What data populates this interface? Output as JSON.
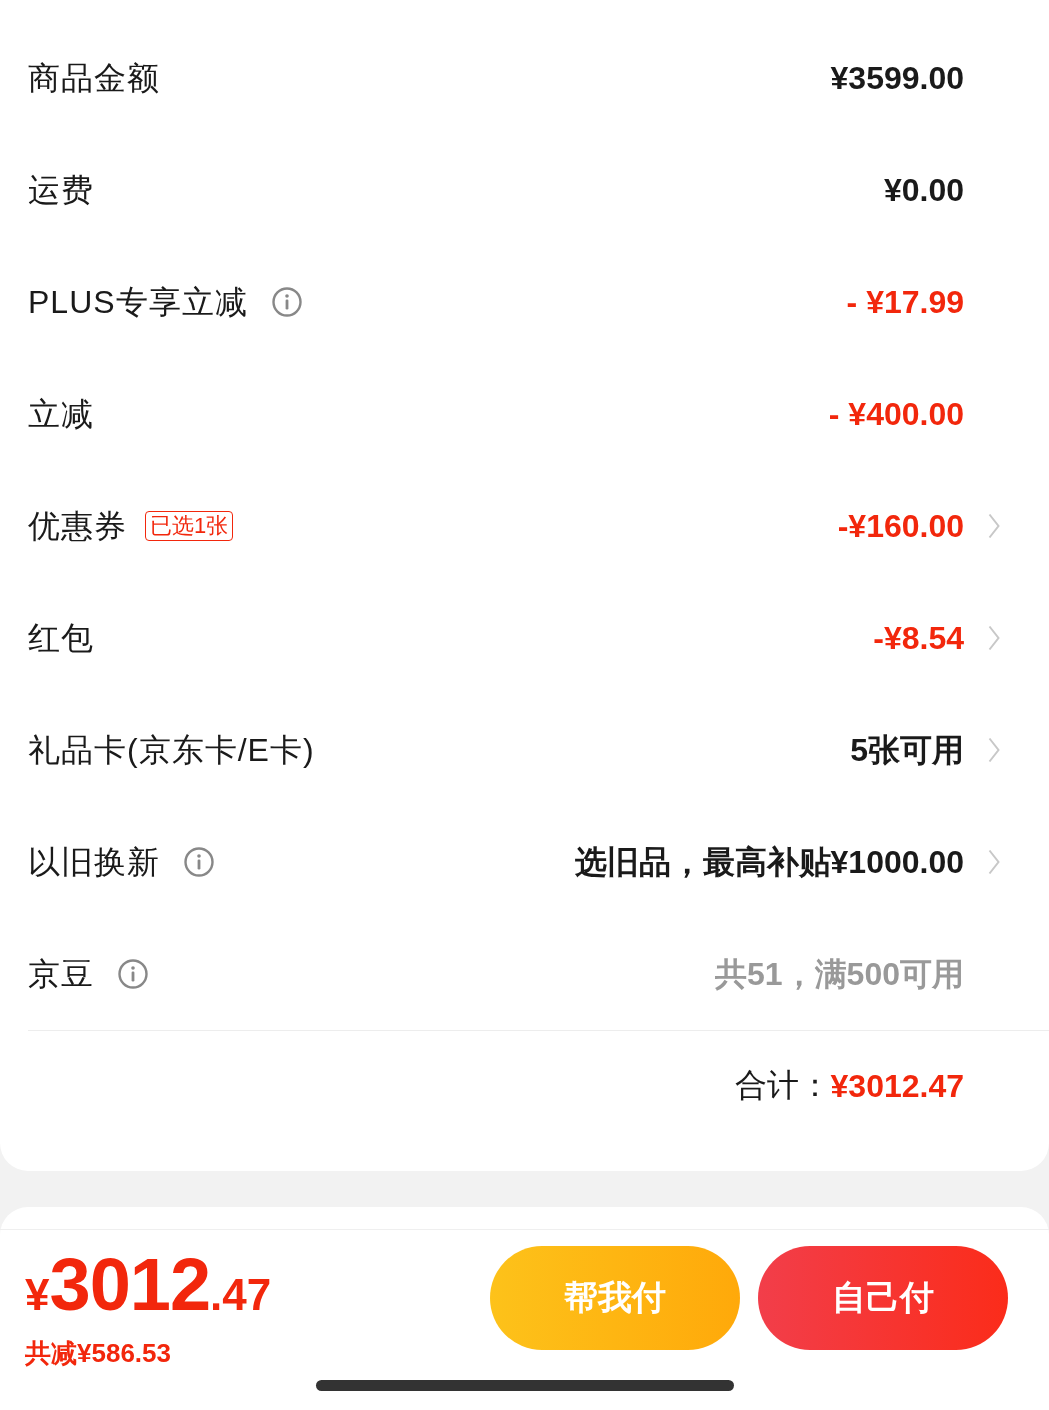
{
  "summary": {
    "rows": [
      {
        "label": "商品金额",
        "info": false,
        "value": "¥3599.00",
        "color": "#1a1a1a",
        "chevron": false
      },
      {
        "label": "运费",
        "info": false,
        "value": "¥0.00",
        "color": "#1a1a1a",
        "chevron": false
      },
      {
        "label": "PLUS专享立减",
        "info": true,
        "value": "- ¥17.99",
        "color": "#f2270c",
        "chevron": false
      },
      {
        "label": "立减",
        "info": false,
        "value": "- ¥400.00",
        "color": "#f2270c",
        "chevron": false
      },
      {
        "label": "优惠券",
        "info": false,
        "badge": "已选1张",
        "value": "-¥160.00",
        "color": "#f2270c",
        "chevron": true
      },
      {
        "label": "红包",
        "info": false,
        "value": "-¥8.54",
        "color": "#f2270c",
        "chevron": true
      },
      {
        "label": "礼品卡(京东卡/E卡)",
        "info": false,
        "value": "5张可用",
        "color": "#1a1a1a",
        "chevron": true
      },
      {
        "label": "以旧换新",
        "info": true,
        "value": "选旧品，最高补贴¥1000.00",
        "color": "#1a1a1a",
        "chevron": true
      },
      {
        "label": "京豆",
        "info": true,
        "value": "共51，满500可用",
        "color": "#999999",
        "chevron": false
      }
    ],
    "total": {
      "label": "合计：",
      "amount": "¥3012.47"
    }
  },
  "checkout": {
    "price": {
      "currency": "¥",
      "integer": "3012",
      "decimal": ".47"
    },
    "savings": "共减¥586.53",
    "buttons": [
      {
        "label": "帮我付",
        "kind": "secondary"
      },
      {
        "label": "自己付",
        "kind": "primary"
      }
    ]
  }
}
